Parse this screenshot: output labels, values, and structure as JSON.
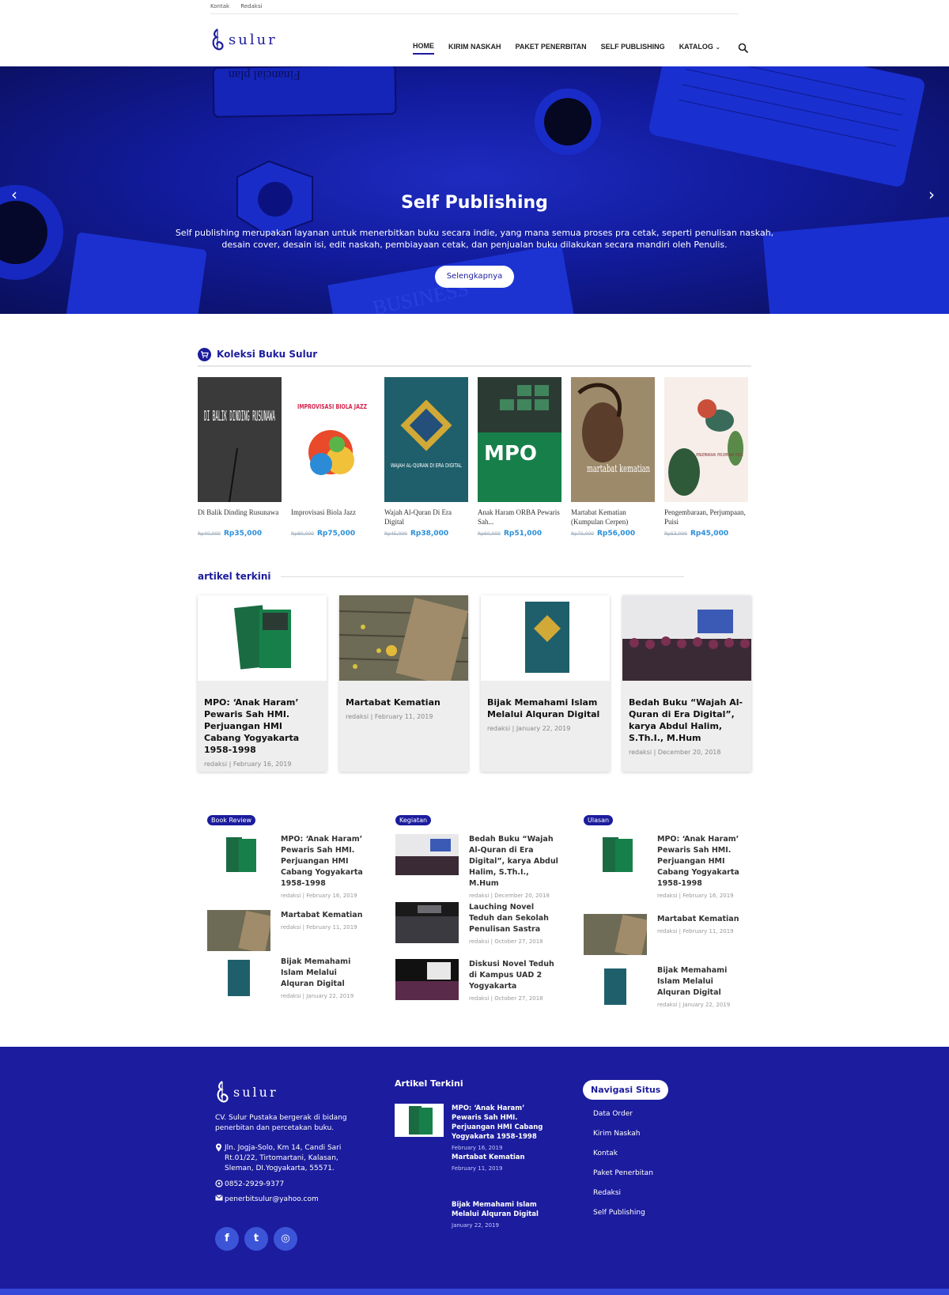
{
  "topbar": {
    "links": [
      "Kontak",
      "Redaksi"
    ]
  },
  "brand": {
    "name": "sulur"
  },
  "nav": {
    "items": [
      "HOME",
      "KIRIM NASKAH",
      "PAKET PENERBITAN",
      "SELF PUBLISHING",
      "KATALOG"
    ],
    "chevron": "⌄"
  },
  "hero": {
    "title": "Self Publishing",
    "text": "Self publishing merupakan layanan untuk menerbitkan buku secara indie, yang mana semua proses pra cetak, seperti penulisan naskah, desain cover, desain isi, edit naskah, pembiayaan cetak, dan penjualan buku dilakukan secara mandiri oleh Penulis.",
    "button": "Selengkapnya",
    "arrow_left": "‹",
    "arrow_right": "›",
    "decor": {
      "notebook": "Financial plan",
      "newspaper": "BUSINESS"
    }
  },
  "collection": {
    "title": "Koleksi Buku Sulur",
    "books": [
      {
        "title": "Di Balik Dinding Rusunawa",
        "old_price": "Rp40,000",
        "price": "Rp35,000",
        "cover_text": "DI BALIK DINDING RUSUNAWA",
        "cover_color": "#3a3a3a"
      },
      {
        "title": "Improvisasi Biola Jazz",
        "old_price": "Rp80,000",
        "price": "Rp75,000",
        "cover_text": "IMPROVISASI BIOLA JAZZ",
        "cover_color": "#ffffff"
      },
      {
        "title": "Wajah Al-Quran Di Era Digital",
        "old_price": "Rp45,000",
        "price": "Rp38,000",
        "cover_text": "WAJAH AL-QURAN DI ERA DIGITAL",
        "cover_color": "#1f5f6b"
      },
      {
        "title": "Anak Haram ORBA Pewaris Sah...",
        "old_price": "Rp60,000",
        "price": "Rp51,000",
        "cover_text": "MPO",
        "cover_color": "#17804a"
      },
      {
        "title": "Martabat Kematian (Kumpulan Cerpen)",
        "old_price": "Rp70,000",
        "price": "Rp56,000",
        "cover_text": "martabat kematian",
        "cover_color": "#9d8a6a"
      },
      {
        "title": "Pengembaraan, Perjumpaan, Puisi",
        "old_price": "Rp53,000",
        "price": "Rp45,000",
        "cover_text": "PENGEMBARAAN PERJUMPAAN PUISI",
        "cover_color": "#f7eee9"
      }
    ]
  },
  "articles": {
    "title": "artikel terkini",
    "items": [
      {
        "title": "MPO: ‘Anak Haram’ Pewaris Sah HMI. Perjuangan HMI Cabang Yogyakarta 1958-1998",
        "meta": "redaksi | February 16, 2019"
      },
      {
        "title": "Martabat Kematian",
        "meta": "redaksi | February 11, 2019"
      },
      {
        "title": "Bijak Memahami Islam Melalui Alquran Digital",
        "meta": "redaksi | January 22, 2019"
      },
      {
        "title": "Bedah Buku “Wajah Al-Quran di Era Digital”, karya Abdul Halim, S.Th.I., M.Hum",
        "meta": "redaksi | December 20, 2018"
      }
    ]
  },
  "columns": [
    {
      "badge": "Book Review",
      "items": [
        {
          "title": "MPO: ‘Anak Haram’ Pewaris Sah HMI. Perjuangan HMI Cabang Yogyakarta 1958-1998",
          "meta": "redaksi | February 16, 2019"
        },
        {
          "title": "Martabat Kematian",
          "meta": "redaksi | February 11, 2019"
        },
        {
          "title": "Bijak Memahami Islam Melalui Alquran Digital",
          "meta": "redaksi | January 22, 2019"
        }
      ]
    },
    {
      "badge": "Kegiatan",
      "items": [
        {
          "title": "Bedah Buku “Wajah Al-Quran di Era Digital”, karya Abdul Halim, S.Th.I., M.Hum",
          "meta": "redaksi | December 20, 2018"
        },
        {
          "title": "Lauching Novel Teduh dan Sekolah Penulisan Sastra",
          "meta": "redaksi | October 27, 2018"
        },
        {
          "title": "Diskusi Novel Teduh di Kampus UAD 2 Yogyakarta",
          "meta": "redaksi | October 27, 2018"
        }
      ]
    },
    {
      "badge": "Ulasan",
      "items": [
        {
          "title": "MPO: ‘Anak Haram’ Pewaris Sah HMI. Perjuangan HMI Cabang Yogyakarta 1958-1998",
          "meta": "redaksi | February 16, 2019"
        },
        {
          "title": "Martabat Kematian",
          "meta": "redaksi | February 11, 2019"
        },
        {
          "title": "Bijak Memahami Islam Melalui Alquran Digital",
          "meta": "redaksi | January 22, 2019"
        }
      ]
    }
  ],
  "footer": {
    "about": "CV. Sulur Pustaka bergerak di bidang penerbitan dan percetakan buku.",
    "address": "Jln. Jogja-Solo, Km 14, Candi Sari Rt.01/22, Tirtomartani, Kalasan, Sleman, DI.Yogyakarta, 55571.",
    "phone": "0852-2929-9377",
    "email": "penerbitsulur@yahoo.com",
    "social": [
      "f",
      "t",
      "◎"
    ],
    "articles_title": "Artikel Terkini",
    "articles": [
      {
        "title": "MPO: ‘Anak Haram’ Pewaris Sah HMI. Perjuangan HMI Cabang Yogyakarta 1958-1998",
        "meta": "February 16, 2019"
      },
      {
        "title": "Martabat Kematian",
        "meta": "February 11, 2019"
      },
      {
        "title": "Bijak Memahami Islam Melalui Alquran Digital",
        "meta": "January 22, 2019"
      }
    ],
    "nav_title": "Navigasi Situs",
    "nav": [
      "Data Order",
      "Kirim Naskah",
      "Kontak",
      "Paket Penerbitan",
      "Redaksi",
      "Self Publishing"
    ]
  },
  "colors": {
    "primary": "#1c1c9e",
    "price": "#2a8fd9",
    "hero": "#121b9c"
  },
  "icons": [
    "sulur-logo-icon",
    "search-icon",
    "cart-icon",
    "map-pin-icon",
    "whatsapp-icon",
    "mail-icon",
    "facebook-icon",
    "twitter-icon",
    "instagram-icon"
  ]
}
